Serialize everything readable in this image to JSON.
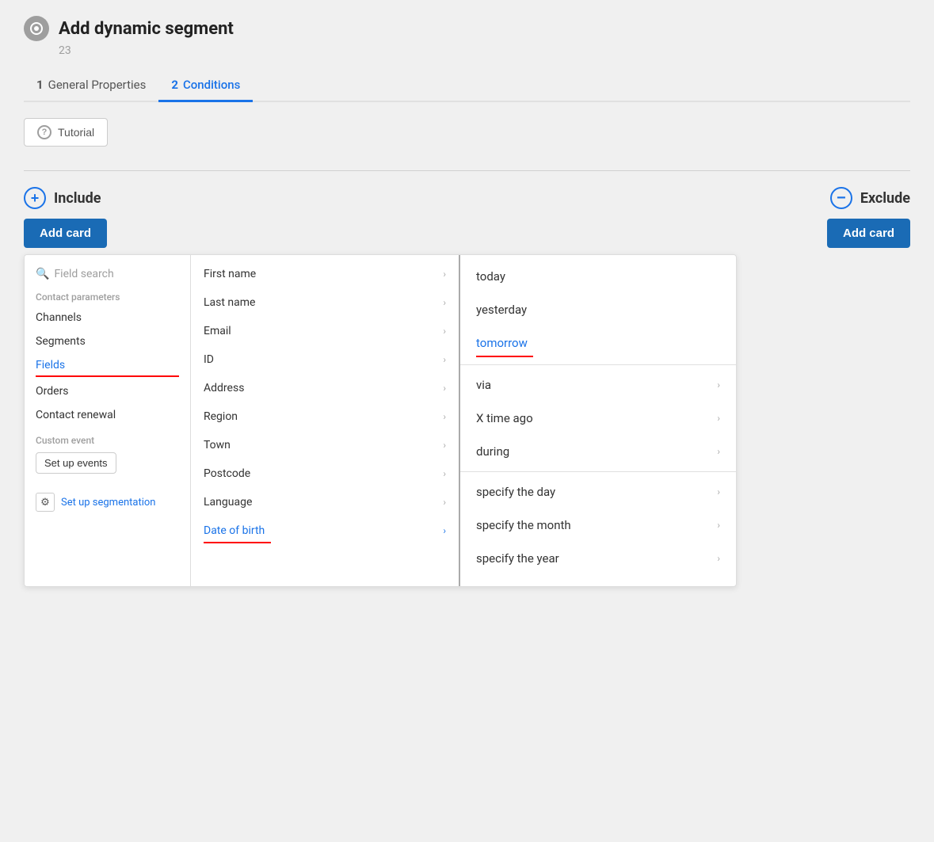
{
  "page": {
    "title": "Add dynamic segment",
    "subtitle": "23"
  },
  "tabs": [
    {
      "number": "1",
      "label": "General Properties",
      "active": false
    },
    {
      "number": "2",
      "label": "Conditions",
      "active": true
    }
  ],
  "tutorial_btn": "Tutorial",
  "include": {
    "label": "Include",
    "add_card": "Add card"
  },
  "exclude": {
    "label": "Exclude",
    "add_card": "Add card"
  },
  "sidebar": {
    "search_placeholder": "Field search",
    "contact_params_label": "Contact parameters",
    "items": [
      {
        "id": "channels",
        "label": "Channels",
        "active": false
      },
      {
        "id": "segments",
        "label": "Segments",
        "active": false
      },
      {
        "id": "fields",
        "label": "Fields",
        "active": true
      },
      {
        "id": "orders",
        "label": "Orders",
        "active": false
      },
      {
        "id": "contact-renewal",
        "label": "Contact renewal",
        "active": false
      }
    ],
    "custom_event_label": "Custom event",
    "setup_events_btn": "Set up events",
    "setup_segmentation": "Set up segmentation"
  },
  "fields": [
    {
      "id": "first-name",
      "label": "First name"
    },
    {
      "id": "last-name",
      "label": "Last name"
    },
    {
      "id": "email",
      "label": "Email"
    },
    {
      "id": "id",
      "label": "ID"
    },
    {
      "id": "address",
      "label": "Address"
    },
    {
      "id": "region",
      "label": "Region"
    },
    {
      "id": "town",
      "label": "Town"
    },
    {
      "id": "postcode",
      "label": "Postcode"
    },
    {
      "id": "language",
      "label": "Language"
    },
    {
      "id": "date-of-birth",
      "label": "Date of birth",
      "active": true
    }
  ],
  "options": [
    {
      "id": "today",
      "label": "today",
      "has_arrow": false
    },
    {
      "id": "yesterday",
      "label": "yesterday",
      "has_arrow": false
    },
    {
      "id": "tomorrow",
      "label": "tomorrow",
      "has_arrow": false,
      "selected": true,
      "red_underline": true
    },
    {
      "id": "via",
      "label": "via",
      "has_arrow": true
    },
    {
      "id": "x-time-ago",
      "label": "X time ago",
      "has_arrow": true
    },
    {
      "id": "during",
      "label": "during",
      "has_arrow": true
    },
    {
      "id": "specify-day",
      "label": "specify the day",
      "has_arrow": true
    },
    {
      "id": "specify-month",
      "label": "specify the month",
      "has_arrow": true
    },
    {
      "id": "specify-year",
      "label": "specify the year",
      "has_arrow": true
    }
  ]
}
